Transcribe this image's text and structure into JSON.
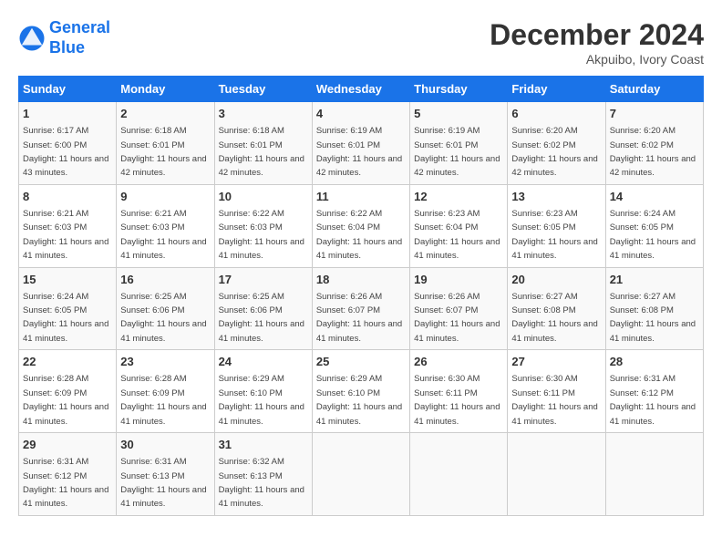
{
  "header": {
    "logo_line1": "General",
    "logo_line2": "Blue",
    "month": "December 2024",
    "location": "Akpuibo, Ivory Coast"
  },
  "days_of_week": [
    "Sunday",
    "Monday",
    "Tuesday",
    "Wednesday",
    "Thursday",
    "Friday",
    "Saturday"
  ],
  "weeks": [
    [
      {
        "day": 1,
        "sunrise": "6:17 AM",
        "sunset": "6:00 PM",
        "daylight": "11 hours and 43 minutes."
      },
      {
        "day": 2,
        "sunrise": "6:18 AM",
        "sunset": "6:01 PM",
        "daylight": "11 hours and 42 minutes."
      },
      {
        "day": 3,
        "sunrise": "6:18 AM",
        "sunset": "6:01 PM",
        "daylight": "11 hours and 42 minutes."
      },
      {
        "day": 4,
        "sunrise": "6:19 AM",
        "sunset": "6:01 PM",
        "daylight": "11 hours and 42 minutes."
      },
      {
        "day": 5,
        "sunrise": "6:19 AM",
        "sunset": "6:01 PM",
        "daylight": "11 hours and 42 minutes."
      },
      {
        "day": 6,
        "sunrise": "6:20 AM",
        "sunset": "6:02 PM",
        "daylight": "11 hours and 42 minutes."
      },
      {
        "day": 7,
        "sunrise": "6:20 AM",
        "sunset": "6:02 PM",
        "daylight": "11 hours and 42 minutes."
      }
    ],
    [
      {
        "day": 8,
        "sunrise": "6:21 AM",
        "sunset": "6:03 PM",
        "daylight": "11 hours and 41 minutes."
      },
      {
        "day": 9,
        "sunrise": "6:21 AM",
        "sunset": "6:03 PM",
        "daylight": "11 hours and 41 minutes."
      },
      {
        "day": 10,
        "sunrise": "6:22 AM",
        "sunset": "6:03 PM",
        "daylight": "11 hours and 41 minutes."
      },
      {
        "day": 11,
        "sunrise": "6:22 AM",
        "sunset": "6:04 PM",
        "daylight": "11 hours and 41 minutes."
      },
      {
        "day": 12,
        "sunrise": "6:23 AM",
        "sunset": "6:04 PM",
        "daylight": "11 hours and 41 minutes."
      },
      {
        "day": 13,
        "sunrise": "6:23 AM",
        "sunset": "6:05 PM",
        "daylight": "11 hours and 41 minutes."
      },
      {
        "day": 14,
        "sunrise": "6:24 AM",
        "sunset": "6:05 PM",
        "daylight": "11 hours and 41 minutes."
      }
    ],
    [
      {
        "day": 15,
        "sunrise": "6:24 AM",
        "sunset": "6:05 PM",
        "daylight": "11 hours and 41 minutes."
      },
      {
        "day": 16,
        "sunrise": "6:25 AM",
        "sunset": "6:06 PM",
        "daylight": "11 hours and 41 minutes."
      },
      {
        "day": 17,
        "sunrise": "6:25 AM",
        "sunset": "6:06 PM",
        "daylight": "11 hours and 41 minutes."
      },
      {
        "day": 18,
        "sunrise": "6:26 AM",
        "sunset": "6:07 PM",
        "daylight": "11 hours and 41 minutes."
      },
      {
        "day": 19,
        "sunrise": "6:26 AM",
        "sunset": "6:07 PM",
        "daylight": "11 hours and 41 minutes."
      },
      {
        "day": 20,
        "sunrise": "6:27 AM",
        "sunset": "6:08 PM",
        "daylight": "11 hours and 41 minutes."
      },
      {
        "day": 21,
        "sunrise": "6:27 AM",
        "sunset": "6:08 PM",
        "daylight": "11 hours and 41 minutes."
      }
    ],
    [
      {
        "day": 22,
        "sunrise": "6:28 AM",
        "sunset": "6:09 PM",
        "daylight": "11 hours and 41 minutes."
      },
      {
        "day": 23,
        "sunrise": "6:28 AM",
        "sunset": "6:09 PM",
        "daylight": "11 hours and 41 minutes."
      },
      {
        "day": 24,
        "sunrise": "6:29 AM",
        "sunset": "6:10 PM",
        "daylight": "11 hours and 41 minutes."
      },
      {
        "day": 25,
        "sunrise": "6:29 AM",
        "sunset": "6:10 PM",
        "daylight": "11 hours and 41 minutes."
      },
      {
        "day": 26,
        "sunrise": "6:30 AM",
        "sunset": "6:11 PM",
        "daylight": "11 hours and 41 minutes."
      },
      {
        "day": 27,
        "sunrise": "6:30 AM",
        "sunset": "6:11 PM",
        "daylight": "11 hours and 41 minutes."
      },
      {
        "day": 28,
        "sunrise": "6:31 AM",
        "sunset": "6:12 PM",
        "daylight": "11 hours and 41 minutes."
      }
    ],
    [
      {
        "day": 29,
        "sunrise": "6:31 AM",
        "sunset": "6:12 PM",
        "daylight": "11 hours and 41 minutes."
      },
      {
        "day": 30,
        "sunrise": "6:31 AM",
        "sunset": "6:13 PM",
        "daylight": "11 hours and 41 minutes."
      },
      {
        "day": 31,
        "sunrise": "6:32 AM",
        "sunset": "6:13 PM",
        "daylight": "11 hours and 41 minutes."
      },
      null,
      null,
      null,
      null
    ]
  ]
}
